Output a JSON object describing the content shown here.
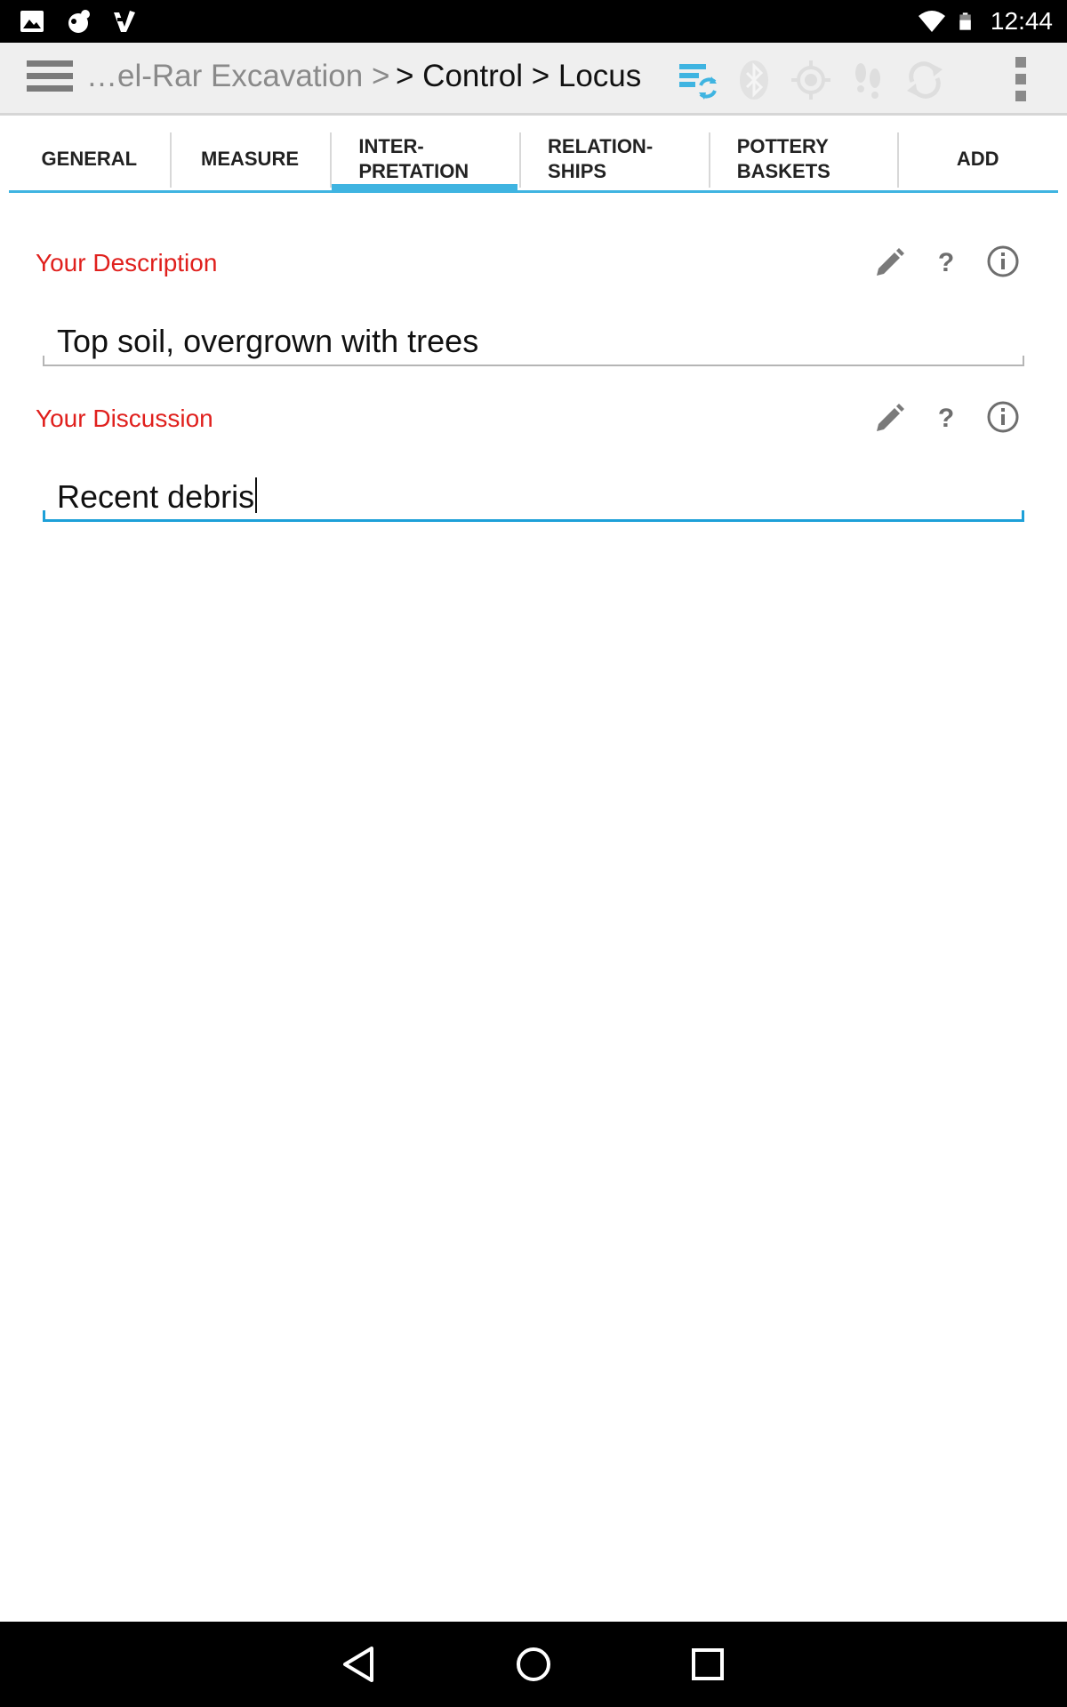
{
  "status_bar": {
    "time": "12:44",
    "left_icons": [
      "image-notification-icon",
      "cloud-notification-icon",
      "tasks-notification-icon"
    ],
    "right_icons": [
      "wifi-icon",
      "battery-icon"
    ]
  },
  "action_bar": {
    "breadcrumb_prev": "…el-Rar Excavation >",
    "breadcrumb_current": "> Control > Locus",
    "icons": [
      "sync-icon",
      "bluetooth-icon",
      "gps-icon",
      "footsteps-icon",
      "refresh-icon"
    ],
    "accent_color": "#3fb4e1"
  },
  "tabs": [
    {
      "label": "GENERAL"
    },
    {
      "label": "MEASURE"
    },
    {
      "label": "INTER-\nPRETATION"
    },
    {
      "label": "RELATION-\nSHIPS"
    },
    {
      "label": "POTTERY\nBASKETS"
    },
    {
      "label": "ADD"
    }
  ],
  "fields": {
    "description": {
      "label": "Your Description",
      "value": "Top soil, overgrown with trees"
    },
    "discussion": {
      "label": "Your Discussion",
      "value": "Recent debris"
    }
  },
  "colors": {
    "label_red": "#e0201d",
    "focus_blue": "#1da0d8"
  }
}
